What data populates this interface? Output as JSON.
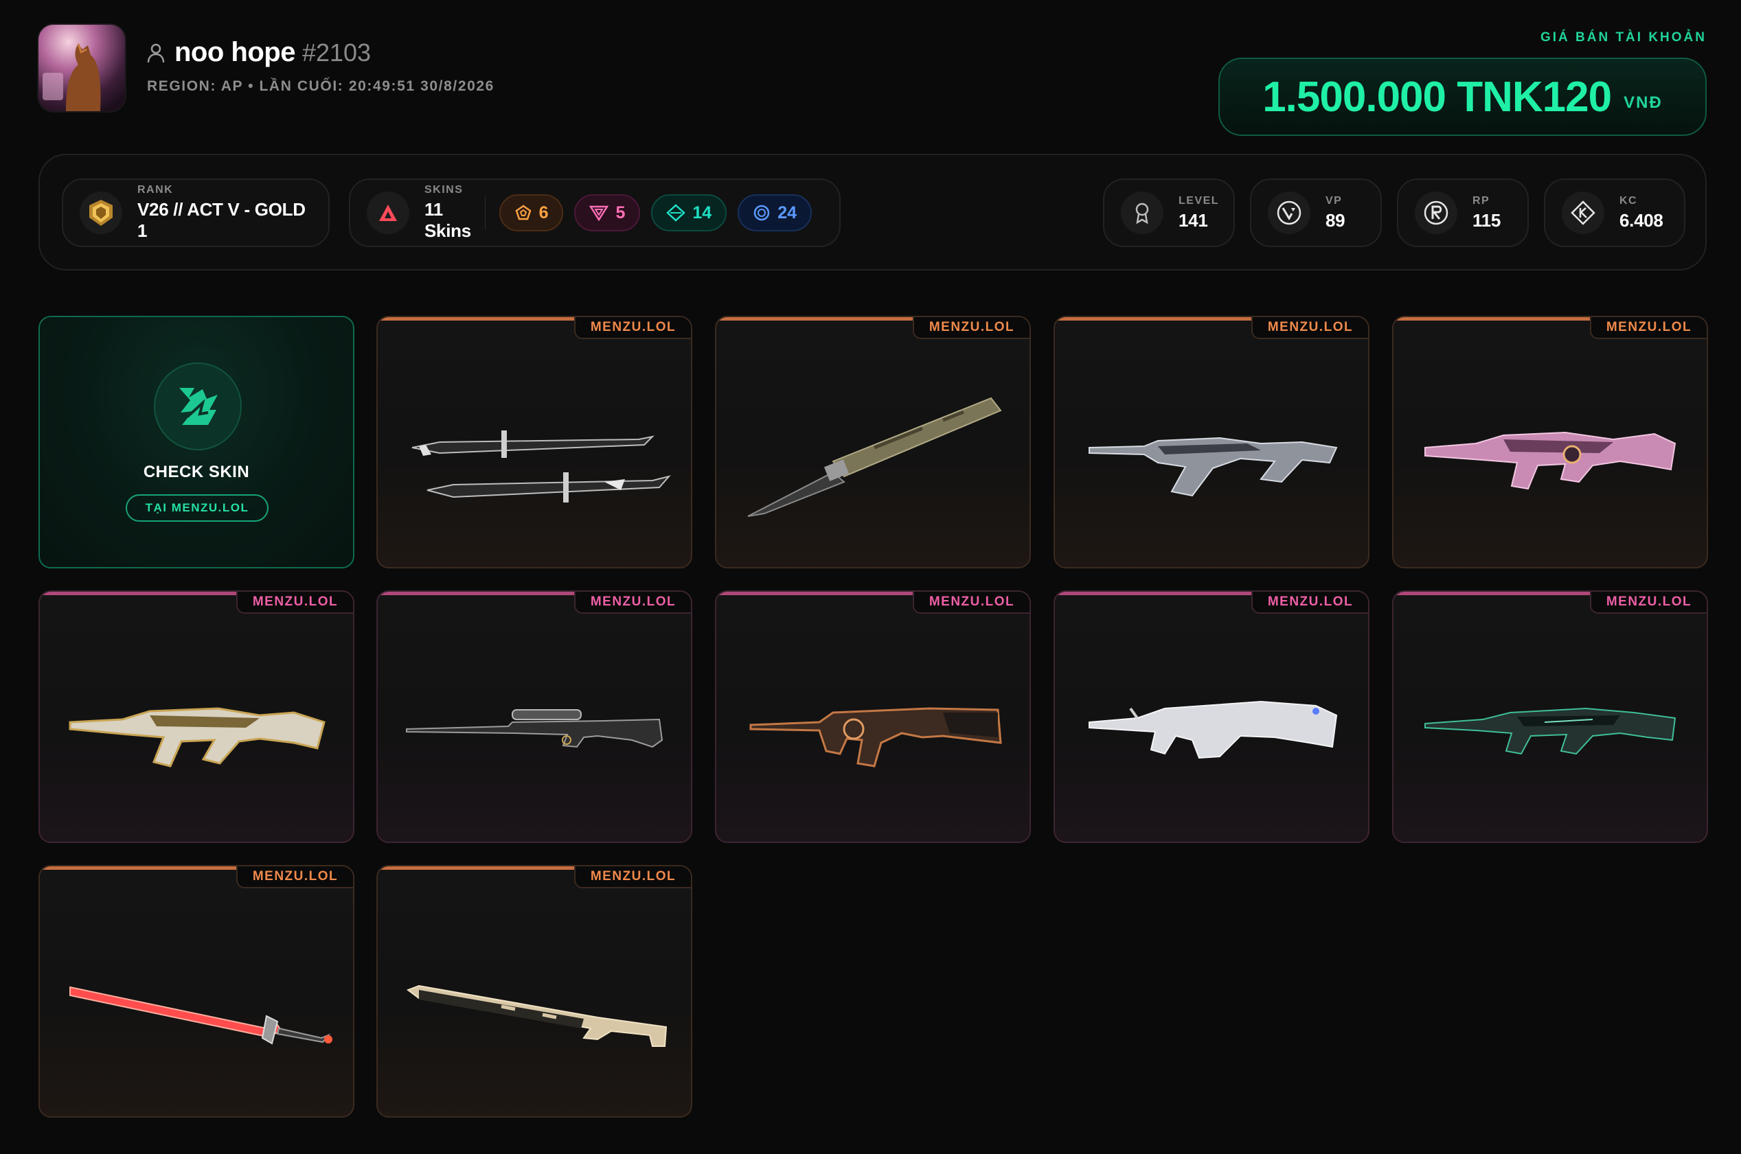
{
  "profile": {
    "username": "noo hope",
    "tag": "#2103",
    "meta": "REGION: AP • LẦN CUỐI: 20:49:51 30/8/2026"
  },
  "price": {
    "label": "GIÁ BÁN TÀI KHOẢN",
    "value": "1.500.000 TNK120",
    "currency": "VNĐ"
  },
  "stats": {
    "rank": {
      "label": "RANK",
      "value": "V26 // ACT V - GOLD 1"
    },
    "skins": {
      "label": "SKINS",
      "value": "11 Skins"
    },
    "tiers": [
      {
        "name": "exclusive",
        "count": "6",
        "color": "#ffa043",
        "icon": "pentagon-icon"
      },
      {
        "name": "ultra",
        "count": "5",
        "color": "#ff6fb5",
        "icon": "triangle-down-icon"
      },
      {
        "name": "premium",
        "count": "14",
        "color": "#1fe0c6",
        "icon": "diamond-icon"
      },
      {
        "name": "deluxe",
        "count": "24",
        "color": "#5a9aff",
        "icon": "circle-icon"
      }
    ],
    "level": {
      "label": "LEVEL",
      "value": "141"
    },
    "vp": {
      "label": "VP",
      "value": "89"
    },
    "rp": {
      "label": "RP",
      "value": "115"
    },
    "kc": {
      "label": "KC",
      "value": "6.408"
    }
  },
  "check": {
    "title": "CHECK SKIN",
    "button": "TẠI MENZU.LOL"
  },
  "cards": [
    {
      "badge": "MENZU.LOL",
      "tier": "orange",
      "weapon": "dual-katana-melee"
    },
    {
      "badge": "MENZU.LOL",
      "tier": "orange",
      "weapon": "butterfly-knife-melee"
    },
    {
      "badge": "MENZU.LOL",
      "tier": "orange",
      "weapon": "silver-rifle"
    },
    {
      "badge": "MENZU.LOL",
      "tier": "orange",
      "weapon": "pink-rifle"
    },
    {
      "badge": "MENZU.LOL",
      "tier": "pink",
      "weapon": "gold-white-rifle"
    },
    {
      "badge": "MENZU.LOL",
      "tier": "pink",
      "weapon": "sniper-rifle"
    },
    {
      "badge": "MENZU.LOL",
      "tier": "pink",
      "weapon": "copper-ak-rifle"
    },
    {
      "badge": "MENZU.LOL",
      "tier": "pink",
      "weapon": "white-rifle"
    },
    {
      "badge": "MENZU.LOL",
      "tier": "pink",
      "weapon": "dark-green-rifle"
    },
    {
      "badge": "MENZU.LOL",
      "tier": "orange",
      "weapon": "red-sword-melee"
    },
    {
      "badge": "MENZU.LOL",
      "tier": "orange",
      "weapon": "tan-sniper"
    }
  ]
}
